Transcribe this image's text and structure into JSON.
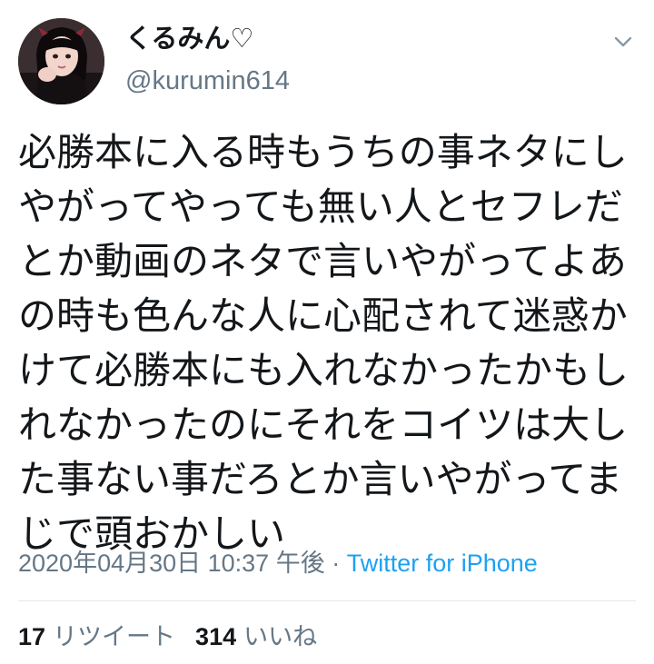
{
  "user": {
    "display_name": "くるみん♡",
    "handle": "@kurumin614",
    "avatar_icon": "profile-photo"
  },
  "tweet": {
    "lines": [
      "必勝本に入る時もうちの事ネタにし",
      "やがってやっても無い人とセフレだ",
      "とか動画のネタで言いやがってよあ",
      "の時も色んな人に心配されて迷惑か",
      "けて必勝本にも入れなかったかもし",
      "れなかったのにそれをコイツは大し",
      "た事ない事だろとか言いやがってま",
      "じで頭おかしい"
    ]
  },
  "meta": {
    "timestamp": "2020年04月30日 10:37 午後",
    "separator": " · ",
    "source": "Twitter for iPhone"
  },
  "stats": {
    "retweets_count": "17",
    "retweets_label": "リツイート",
    "likes_count": "314",
    "likes_label": "いいね"
  },
  "colors": {
    "text": "#14171a",
    "secondary": "#657786",
    "link": "#1da1f2",
    "divider": "#e1e8ed"
  }
}
